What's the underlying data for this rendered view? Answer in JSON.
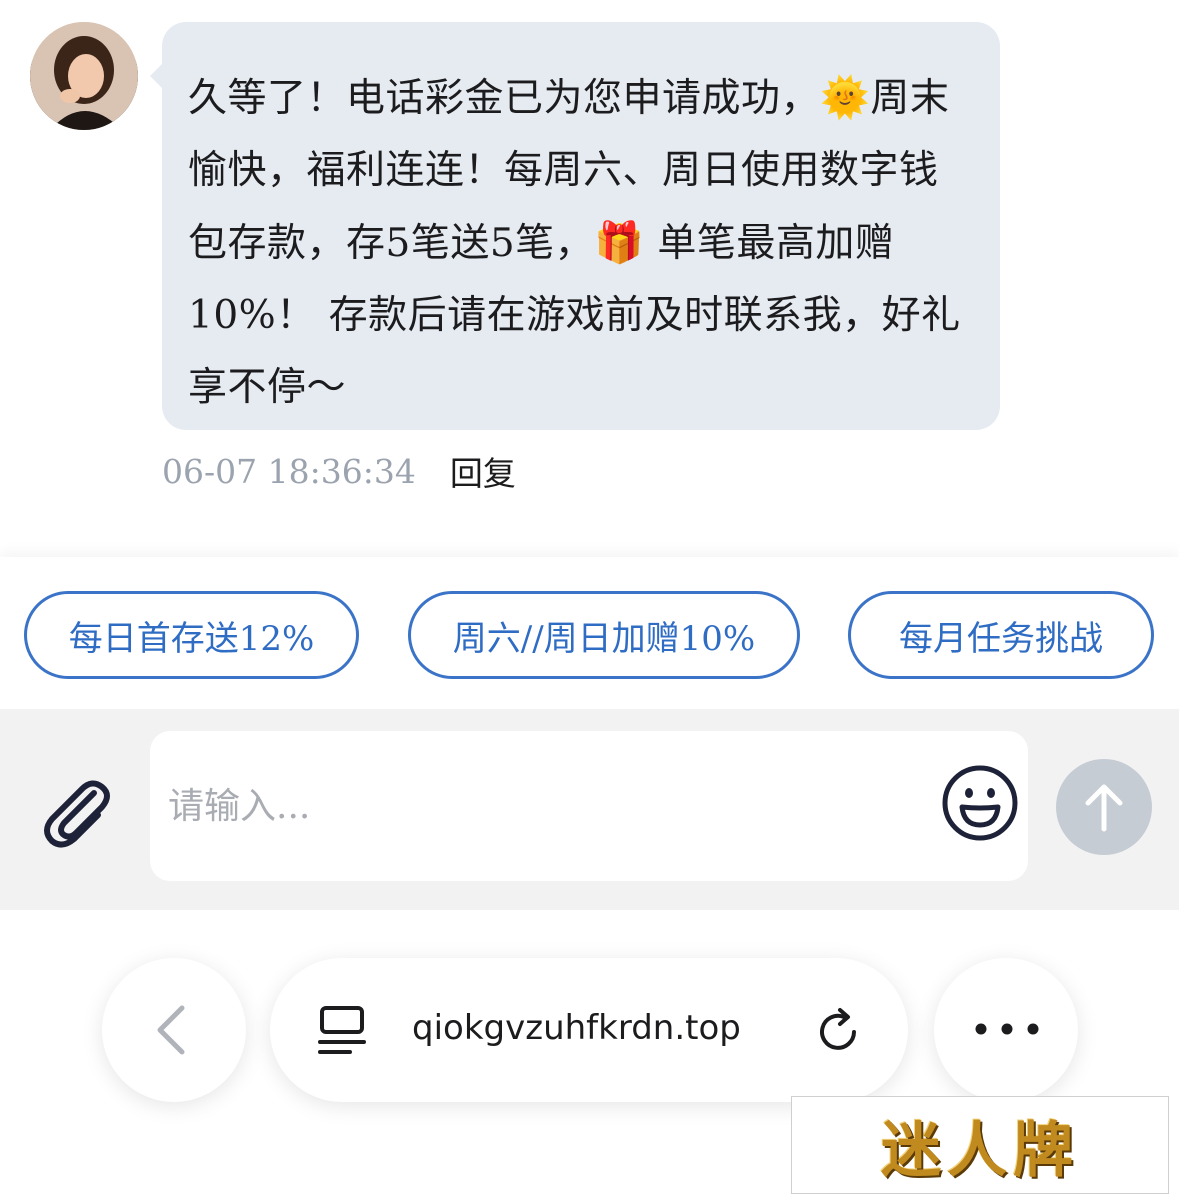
{
  "message": {
    "text_part1": "久等了！电话彩金已为您申请成功，",
    "emoji1": "🌞",
    "text_part2": "周末愉快，福利连连！每周六、周日使用数字钱包存款，存5笔送5笔，",
    "emoji2": "🎁",
    "text_part3": " 单笔最高加赠10%！ 存款后请在游戏前及时联系我，好礼享不停～",
    "timestamp": "06-07 18:36:34",
    "reply_label": "回复"
  },
  "quick_replies": [
    {
      "label": "每日首存送12%"
    },
    {
      "label": "周六//周日加赠10%"
    },
    {
      "label": "每月任务挑战"
    }
  ],
  "composer": {
    "placeholder": "请输入...",
    "value": ""
  },
  "browser": {
    "url": "qiokgvzuhfkrdn.top"
  },
  "watermark": {
    "text": "迷人牌"
  },
  "colors": {
    "bubble": "#e6ebf2",
    "chip_border": "#3a73c7",
    "send_disabled": "#c6ccd3"
  }
}
